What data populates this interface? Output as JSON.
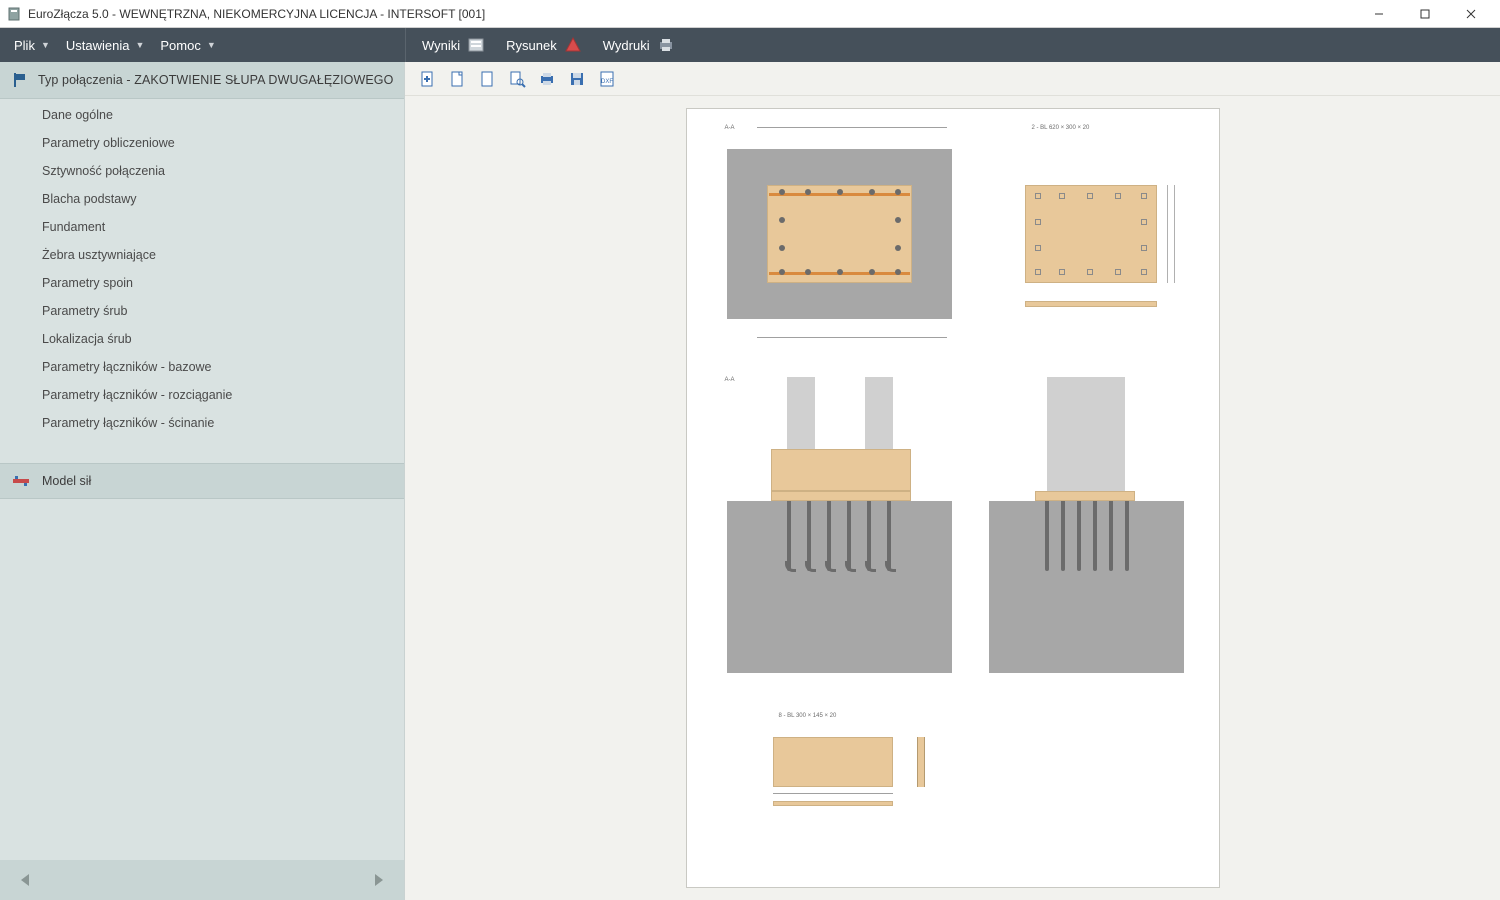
{
  "window": {
    "title": "EuroZłącza 5.0 - WEWNĘTRZNA, NIEKOMERCYJNA LICENCJA - INTERSOFT [001]"
  },
  "menubar_left": {
    "items": [
      {
        "label": "Plik"
      },
      {
        "label": "Ustawienia"
      },
      {
        "label": "Pomoc"
      }
    ]
  },
  "menubar_right": {
    "items": [
      {
        "label": "Wyniki"
      },
      {
        "label": "Rysunek"
      },
      {
        "label": "Wydruki"
      }
    ]
  },
  "doc_toolbar_icons": [
    "new-page-plus-icon",
    "page-icon",
    "page-blank-icon",
    "page-search-icon",
    "print-icon",
    "save-icon",
    "export-dxf-icon"
  ],
  "sidebar": {
    "header": {
      "prefix": "Typ połączenia - ",
      "name": "ZAKOTWIENIE SŁUPA DWUGAŁĘZIOWEGO"
    },
    "items": [
      {
        "label": "Dane ogólne"
      },
      {
        "label": "Parametry obliczeniowe"
      },
      {
        "label": "Sztywność połączenia"
      },
      {
        "label": "Blacha podstawy"
      },
      {
        "label": "Fundament"
      },
      {
        "label": "Żebra usztywniające"
      },
      {
        "label": "Parametry spoin"
      },
      {
        "label": "Parametry śrub"
      },
      {
        "label": "Lokalizacja śrub"
      },
      {
        "label": "Parametry łączników - bazowe"
      },
      {
        "label": "Parametry łączników - rozciąganie"
      },
      {
        "label": "Parametry łączników - ścinanie"
      }
    ],
    "footer_item": {
      "label": "Model sił"
    }
  },
  "drawing": {
    "labels": {
      "top_right_caption": "2 - BL 620 × 300 × 20",
      "bottom_caption": "8 - BL 300 × 145 × 20",
      "elev_left": "A-A",
      "plan_left": "A-A"
    }
  }
}
